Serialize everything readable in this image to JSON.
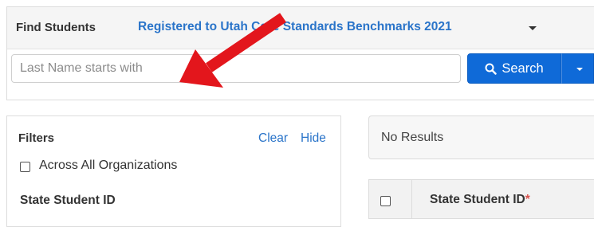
{
  "header": {
    "title": "Find Students",
    "registered_link": "Registered to Utah Core Standards Benchmarks 2021"
  },
  "search": {
    "placeholder": "Last Name starts with",
    "value": "",
    "button_label": "Search",
    "button_icon": "magnifier-icon"
  },
  "filters": {
    "title": "Filters",
    "clear_label": "Clear",
    "hide_label": "Hide",
    "across_label": "Across All Organizations",
    "state_student_id_label": "State Student ID"
  },
  "results": {
    "status": "No Results",
    "columns": [
      {
        "label": "State Student ID",
        "required_marker": "*"
      }
    ]
  },
  "colors": {
    "accent_blue": "#0f6ad8",
    "link_blue": "#2a74c9",
    "annotation_arrow": "#e3161c",
    "required_red": "#d9534f"
  },
  "annotation": {
    "icon": "red-arrow-icon"
  }
}
